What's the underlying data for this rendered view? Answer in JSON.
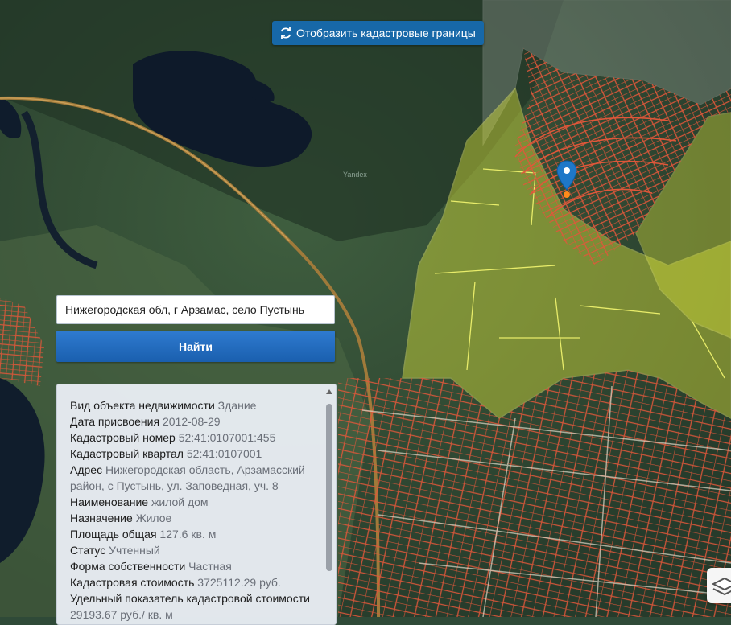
{
  "toolbar": {
    "show_cadastral_label": "Отобразить кадастровые границы"
  },
  "search": {
    "value": "Нижегородская обл, г Арзамас, село Пустынь",
    "button_label": "Найти"
  },
  "map": {
    "watermark": "Yandex",
    "parcel_color": "#e0573a",
    "field_color": "#d8e03a",
    "button_color": "#1768a8"
  },
  "info": {
    "rows": [
      {
        "label": "Вид объекта недвижимости",
        "value": "Здание"
      },
      {
        "label": "Дата присвоения",
        "value": "2012-08-29"
      },
      {
        "label": "Кадастровый номер",
        "value": "52:41:0107001:455"
      },
      {
        "label": "Кадастровый квартал",
        "value": "52:41:0107001"
      },
      {
        "label": "Адрес",
        "value": "Нижегородская область, Арзамасский район, с Пустынь, ул. Заповедная, уч. 8"
      },
      {
        "label": "Наименование",
        "value": "жилой дом"
      },
      {
        "label": "Назначение",
        "value": "Жилое"
      },
      {
        "label": "Площадь общая",
        "value": "127.6 кв. м"
      },
      {
        "label": "Статус",
        "value": "Учтенный"
      },
      {
        "label": "Форма собственности",
        "value": "Частная"
      },
      {
        "label": "Кадастровая стоимость",
        "value": "3725112.29 руб."
      },
      {
        "label": "Удельный показатель кадастровой стоимости",
        "value": "29193.67 руб./ кв. м"
      }
    ]
  }
}
